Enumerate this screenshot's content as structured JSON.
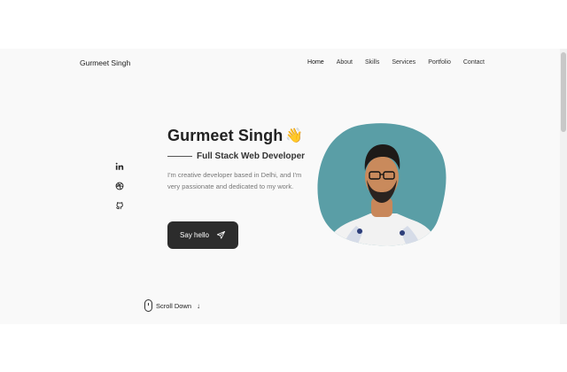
{
  "header": {
    "logo": "Gurmeet Singh",
    "nav": [
      {
        "label": "Home",
        "active": true
      },
      {
        "label": "About"
      },
      {
        "label": "Skills"
      },
      {
        "label": "Services"
      },
      {
        "label": "Portfolio"
      },
      {
        "label": "Contact"
      }
    ]
  },
  "socials": [
    {
      "icon": "linkedin-icon"
    },
    {
      "icon": "dribbble-icon"
    },
    {
      "icon": "github-icon"
    }
  ],
  "hero": {
    "name": "Gurmeet Singh",
    "wave_emoji": "👋",
    "subtitle": "Full Stack Web Developer",
    "description": "I'm creative developer based in Delhi, and I'm very passionate and dedicated to my work.",
    "cta_label": "Say hello"
  },
  "scroll": {
    "label": "Scroll Down"
  },
  "colors": {
    "background": "#f9f9f9",
    "button": "#2c2c2c",
    "blob": "#5a9ea6",
    "text_dark": "#222222",
    "text_muted": "#777777"
  }
}
